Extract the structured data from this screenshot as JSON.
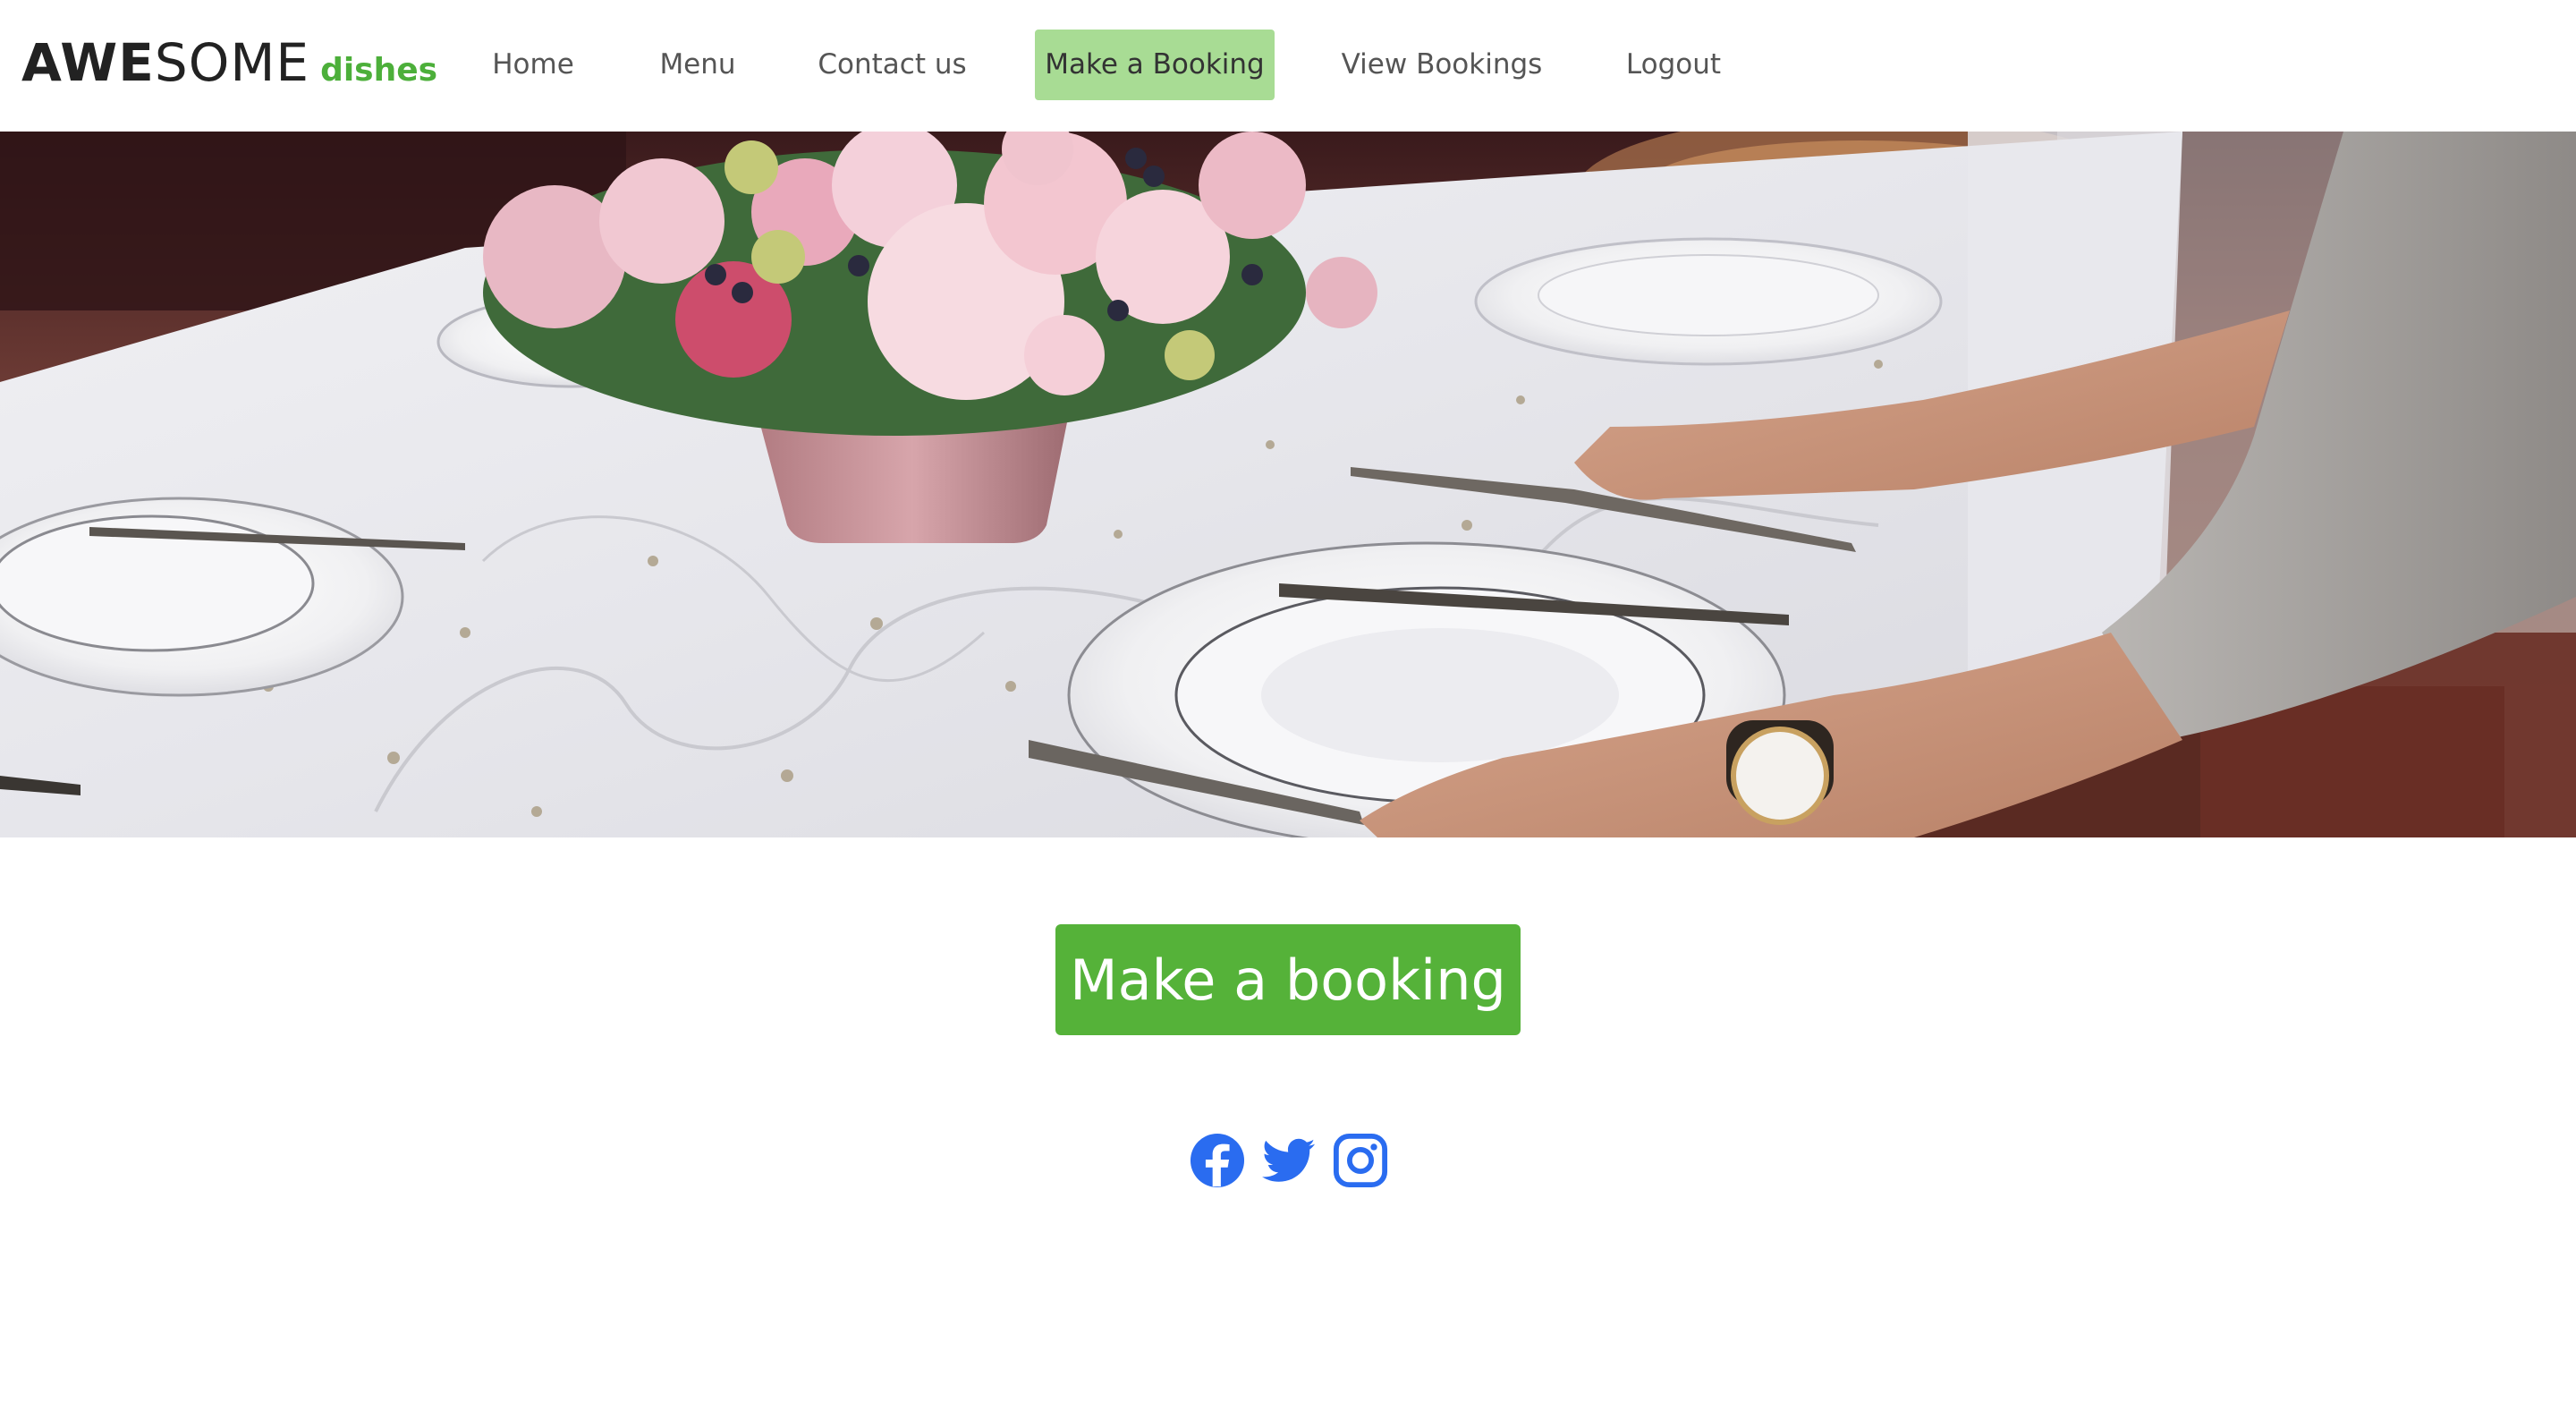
{
  "brand": {
    "part1": "AWE",
    "part2": "SOME",
    "part3": "dishes"
  },
  "nav": {
    "items": [
      {
        "label": "Home"
      },
      {
        "label": "Menu"
      },
      {
        "label": "Contact us"
      },
      {
        "label": "Make a Booking",
        "active": true
      },
      {
        "label": "View Bookings"
      },
      {
        "label": "Logout"
      }
    ]
  },
  "hero": {
    "image": "table-setting-with-flowers-and-plates"
  },
  "cta": {
    "label": "Make a booking"
  },
  "social": {
    "icons": [
      "facebook-icon",
      "twitter-icon",
      "instagram-icon"
    ]
  },
  "colors": {
    "brand_green": "#4caf3a",
    "active_nav_bg": "#a8dc94",
    "cta_green": "#55b239",
    "social_blue": "#2a6cf0",
    "nav_text": "#555555"
  }
}
